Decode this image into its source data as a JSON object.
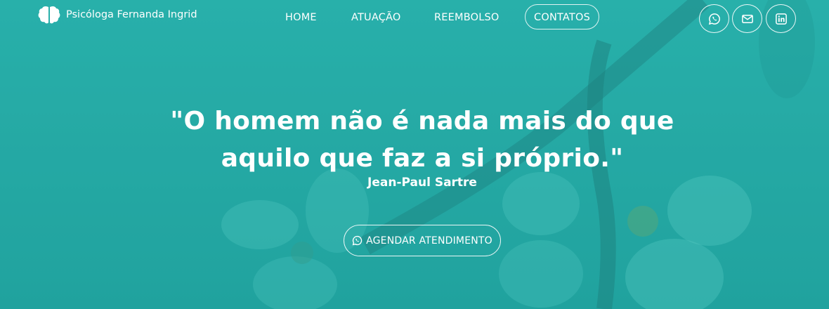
{
  "brand": {
    "name": "Psicóloga Fernanda Ingrid",
    "logo_icon": "brain-icon"
  },
  "nav": {
    "items": [
      {
        "label": "HOME"
      },
      {
        "label": "ATUAÇÃO"
      },
      {
        "label": "REEMBOLSO"
      },
      {
        "label": "CONTATOS"
      }
    ]
  },
  "social": [
    {
      "icon": "whatsapp-icon"
    },
    {
      "icon": "envelope-icon"
    },
    {
      "icon": "linkedin-icon"
    }
  ],
  "hero": {
    "quote_line1": "\"O homem não é nada mais do que",
    "quote_line2": "aquilo que faz a si próprio.\"",
    "author": "Jean-Paul Sartre",
    "cta_label": "AGENDAR ATENDIMENTO",
    "cta_icon": "whatsapp-icon"
  },
  "colors": {
    "teal": "#27aaa5",
    "white": "#ffffff"
  }
}
